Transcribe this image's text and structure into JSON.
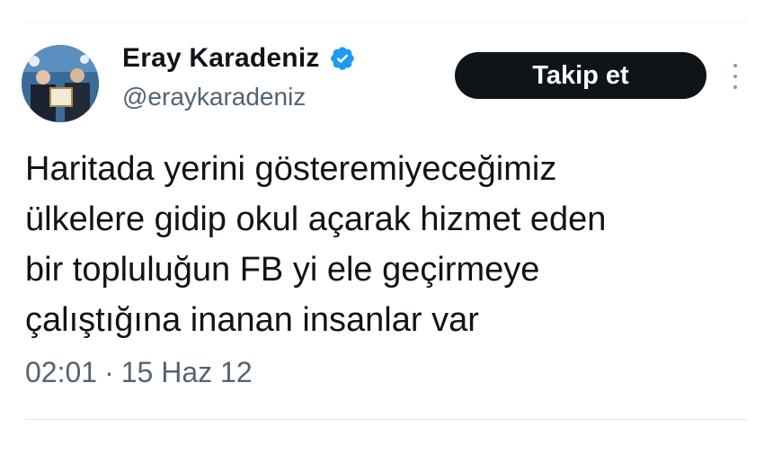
{
  "author": {
    "display_name": "Eray Karadeniz",
    "handle": "@eraykaradeniz",
    "verified": true
  },
  "follow_button": {
    "label": "Takip et"
  },
  "tweet": {
    "lines": [
      "Haritada yerini gösteremiyeceğimiz",
      "ülkelere gidip okul açarak hizmet eden",
      "bir topluluğun FB yi ele geçirmeye",
      "çalıştığına inanan insanlar var"
    ],
    "time": "02:01",
    "separator": "·",
    "date": "15 Haz 12"
  },
  "icons": {
    "verified": "verified-badge-icon",
    "more": "more-options-icon"
  },
  "colors": {
    "verified_blue": "#1d9bf0",
    "button_bg": "#0f1419",
    "secondary_text": "#536471"
  }
}
